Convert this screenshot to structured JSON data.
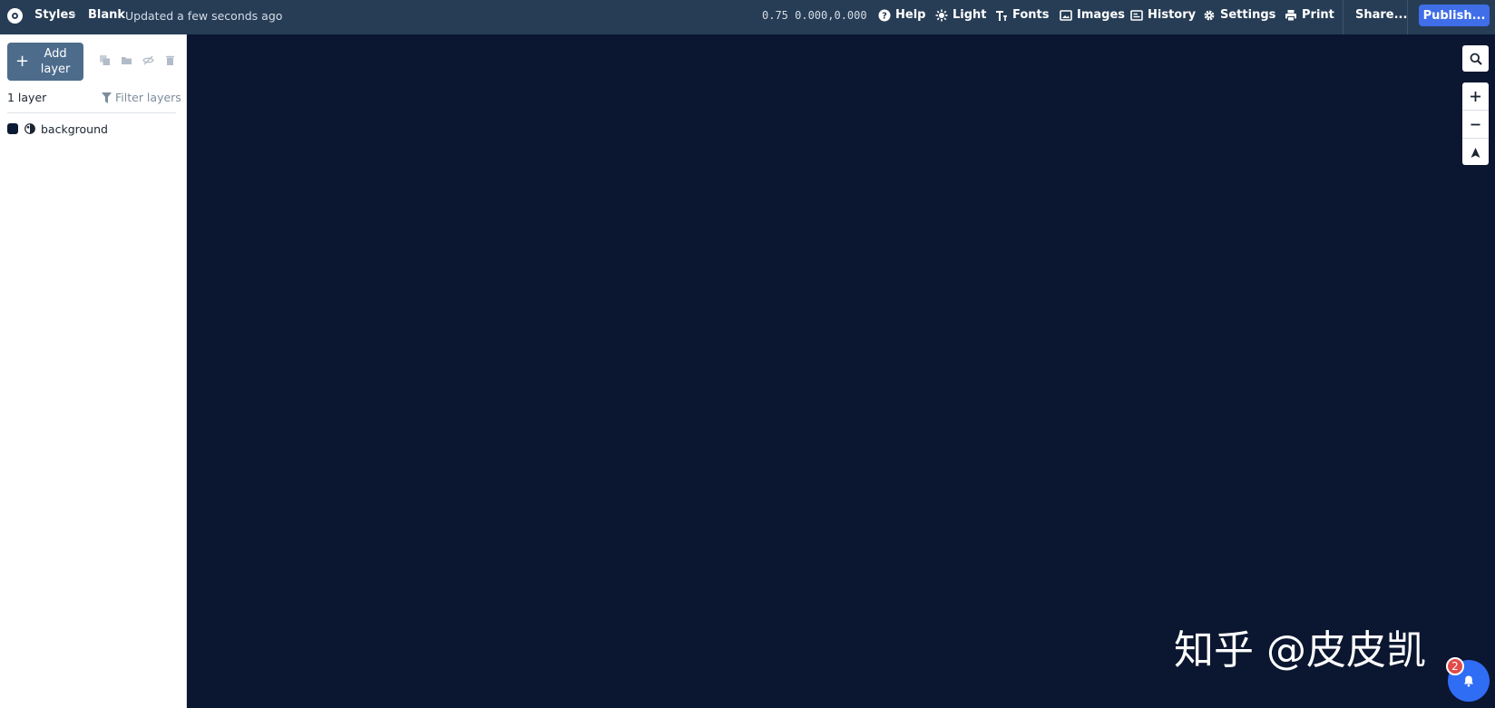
{
  "header": {
    "breadcrumb": {
      "root": "Styles",
      "separator": "›",
      "current": "Blank"
    },
    "updated_status": "Updated a few seconds ago",
    "map_state": "0.75 0.000,0.000",
    "nav": [
      {
        "label": "Help",
        "icon": "help-icon"
      },
      {
        "label": "Light",
        "icon": "sun-icon"
      },
      {
        "label": "Fonts",
        "icon": "fonts-icon"
      },
      {
        "label": "Images",
        "icon": "image-icon"
      },
      {
        "label": "History",
        "icon": "history-icon"
      },
      {
        "label": "Settings",
        "icon": "gear-icon"
      },
      {
        "label": "Print",
        "icon": "print-icon"
      }
    ],
    "share_label": "Share...",
    "publish_label": "Publish..."
  },
  "sidebar": {
    "add_layer_plus": "+",
    "add_layer_label": "Add layer",
    "tools": [
      "duplicate-icon",
      "folder-icon",
      "hide-icon",
      "trash-icon"
    ],
    "layer_count": "1 layer",
    "filter_label": "Filter layers",
    "layers": [
      {
        "name": "background",
        "color": "#0b1b33",
        "icon": "background-layer-icon"
      }
    ]
  },
  "map": {
    "background_color": "#0b1630",
    "controls": [
      "search-icon",
      "zoom-in-icon",
      "zoom-out-icon",
      "compass-icon"
    ]
  },
  "watermark": "知乎 @皮皮凯",
  "notifications": {
    "count": "2",
    "icon": "bell-icon"
  },
  "colors": {
    "topbar": "#273d56",
    "accent": "#3f6ee8",
    "add_layer_button": "#4d6c8c",
    "badge": "#e24a4a"
  }
}
